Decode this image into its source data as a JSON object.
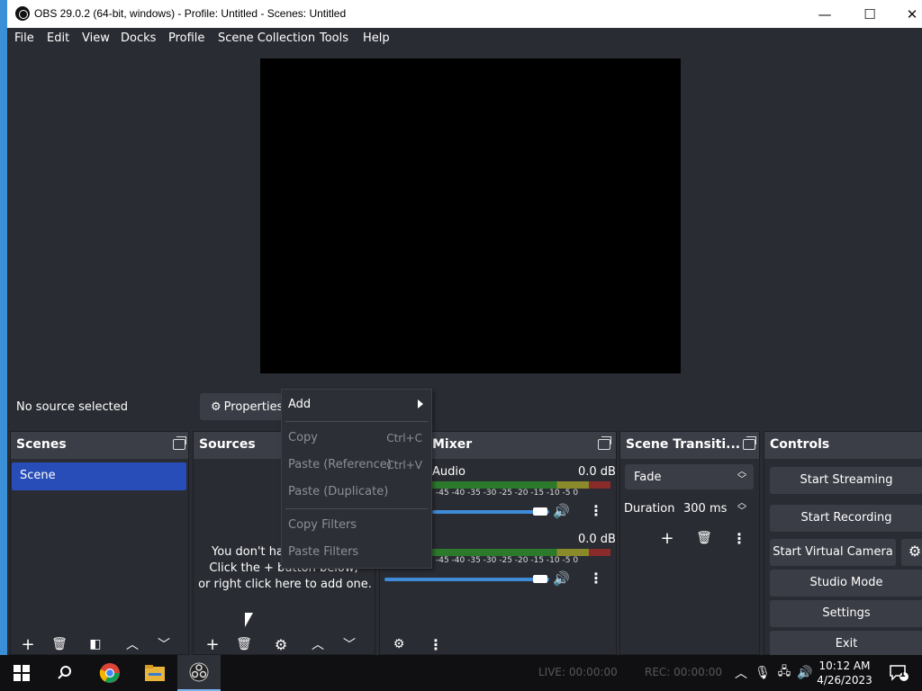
{
  "window": {
    "title": "OBS 29.0.2 (64-bit, windows) - Profile: Untitled - Scenes: Untitled",
    "minimize": "—",
    "maximize": "☐",
    "close": "✕"
  },
  "menubar": [
    "File",
    "Edit",
    "View",
    "Docks",
    "Profile",
    "Scene Collection",
    "Tools",
    "Help"
  ],
  "context_bar": {
    "status": "No source selected",
    "properties_label": "Properties"
  },
  "scenes": {
    "title": "Scenes",
    "items": [
      "Scene"
    ]
  },
  "sources": {
    "title": "Sources",
    "empty_lines": [
      "You don't ha",
      "Click the + button below,",
      "or right click here to add one."
    ]
  },
  "mixer": {
    "title": "Mixer",
    "channels": [
      {
        "name": "Audio",
        "level": "0.0 dB"
      },
      {
        "name": "",
        "level": "0.0 dB"
      }
    ],
    "ticks": "-45 -40 -35 -30 -25 -20 -15 -10 -5 0"
  },
  "transitions": {
    "title": "Scene Transiti...",
    "selected": "Fade",
    "duration_label": "Duration",
    "duration_value": "300 ms"
  },
  "controls": {
    "title": "Controls",
    "buttons": [
      "Start Streaming",
      "Start Recording",
      "Start Virtual Camera",
      "Studio Mode",
      "Settings",
      "Exit"
    ]
  },
  "context_menu": {
    "items": [
      {
        "label": "Add",
        "shortcut": "",
        "disabled": false
      },
      {
        "label": "Copy",
        "shortcut": "Ctrl+C",
        "disabled": true
      },
      {
        "label": "Paste (Reference)",
        "shortcut": "Ctrl+V",
        "disabled": true
      },
      {
        "label": "Paste (Duplicate)",
        "shortcut": "",
        "disabled": true
      },
      {
        "label": "Copy Filters",
        "shortcut": "",
        "disabled": true
      },
      {
        "label": "Paste Filters",
        "shortcut": "",
        "disabled": true
      }
    ]
  },
  "taskbar": {
    "live": "LIVE: 00:00:00",
    "rec": "REC: 00:00:00",
    "time": "10:12 AM",
    "date": "4/26/2023",
    "notification_count": "1"
  },
  "colors": {
    "accent": "#284cb8",
    "background": "#2a2c33",
    "slider": "#3f8bd8"
  }
}
